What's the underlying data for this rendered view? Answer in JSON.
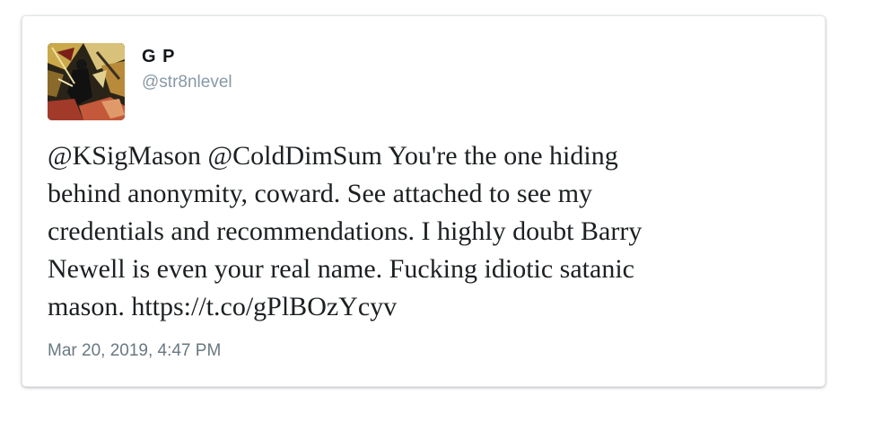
{
  "tweet": {
    "author": {
      "display_name": "G P",
      "handle": "@str8nlevel",
      "avatar_icon": "profile-image"
    },
    "lines": [
      "@KSigMason @ColdDimSum You're the one hiding",
      "behind anonymity, coward. See attached to see my",
      "credentials and recommendations. I highly doubt Barry",
      "Newell is even your real name. Fucking idiotic satanic",
      "mason. https://t.co/gPlBOzYcyv"
    ],
    "timestamp": "Mar 20, 2019, 4:47 PM"
  },
  "colors": {
    "name": "#14171a",
    "handle": "#8899a6",
    "text": "#1c2022",
    "timestamp": "#697882",
    "card_border": "#e1e8ed"
  }
}
